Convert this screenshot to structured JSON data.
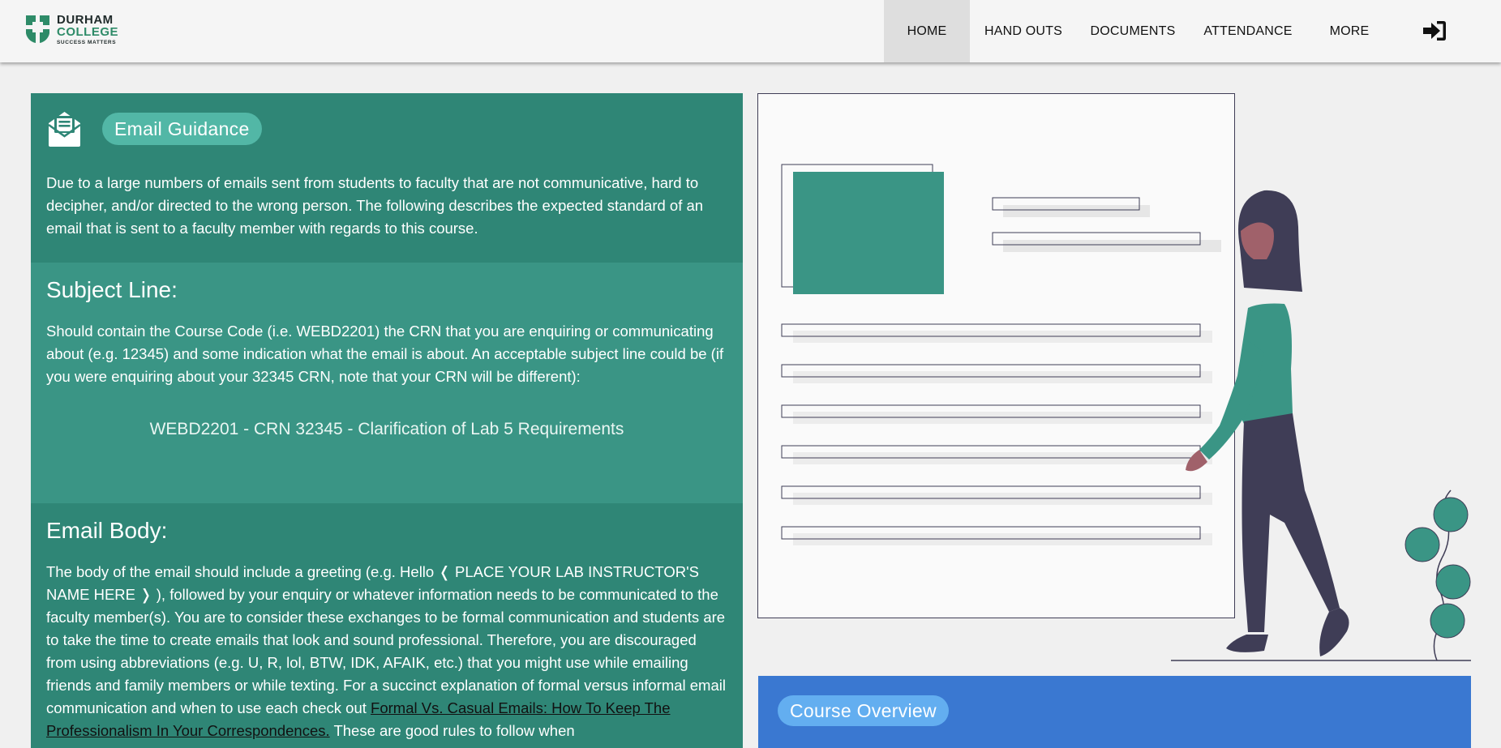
{
  "brand": {
    "line1": "DURHAM",
    "line2": "COLLEGE",
    "tagline": "SUCCESS MATTERS",
    "green": "#2e8b68"
  },
  "nav": {
    "items": [
      {
        "label": "HOME",
        "active": true
      },
      {
        "label": "HAND OUTS",
        "active": false
      },
      {
        "label": "DOCUMENTS",
        "active": false
      },
      {
        "label": "ATTENDANCE",
        "active": false
      },
      {
        "label": "MORE",
        "active": false
      }
    ],
    "login_icon": "sign-in-icon"
  },
  "email_guidance": {
    "icon": "envelope-open-text-icon",
    "title": "Email Guidance",
    "intro": "Due to a large numbers of emails sent from students to faculty that are not communicative, hard to decipher, and/or directed to the wrong person. The following describes the expected standard of an email that is sent to a faculty member with regards to this course.",
    "subject": {
      "heading": "Subject Line:",
      "text": "Should contain the Course Code (i.e. WEBD2201) the CRN that you are enquiring or communicating about (e.g. 12345) and some indication what the email is about. An acceptable subject line could be (if you were enquiring about your 32345 CRN, note that your CRN will be different):",
      "example": "WEBD2201 - CRN 32345 - Clarification of Lab 5 Requirements"
    },
    "body": {
      "heading": "Email Body:",
      "text_before_link": "The body of the email should include a greeting (e.g. Hello ❬ PLACE YOUR LAB INSTRUCTOR'S NAME HERE ❭ ), followed by your enquiry or whatever information needs to be communicated to the faculty member(s). You are to consider these exchanges to be formal communication and students are to take the time to create emails that look and sound professional. Therefore, you are discouraged from using abbreviations (e.g. U, R, lol, BTW, IDK, AFAIK, etc.) that you might use while emailing friends and family members or while texting. For a succinct explanation of formal versus informal email communication and when to use each check out ",
      "link": "Formal Vs. Casual Emails: How To Keep The Professionalism In Your Correspondences.",
      "text_after_link": " These are good rules to follow when"
    }
  },
  "course_overview": {
    "title": "Course Overview"
  },
  "colors": {
    "teal_dark": "#2f8676",
    "teal_mid": "#3a9585",
    "teal_pill": "#52b7a6",
    "blue": "#3a78d1",
    "blue_pill": "#63aef0"
  }
}
